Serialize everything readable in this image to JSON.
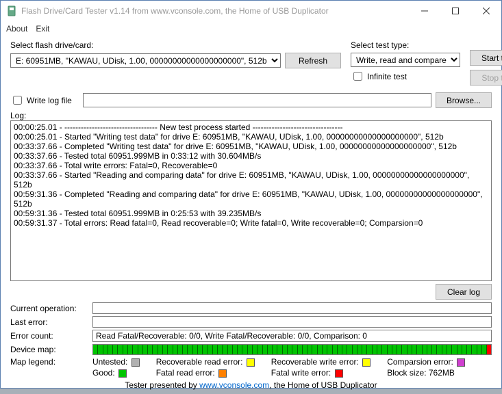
{
  "window": {
    "title": "Flash Drive/Card Tester v1.14 from www.vconsole.com, the Home of USB Duplicator"
  },
  "menu": {
    "about": "About",
    "exit": "Exit"
  },
  "labels": {
    "select_drive": "Select flash drive/card:",
    "select_test": "Select test type:",
    "infinite": "Infinite test",
    "write_log": "Write log file",
    "log": "Log:",
    "current_op": "Current operation:",
    "last_error": "Last error:",
    "error_count": "Error count:",
    "device_map": "Device map:",
    "map_legend": "Map legend:"
  },
  "buttons": {
    "refresh": "Refresh",
    "start": "Start test",
    "stop": "Stop test",
    "browse": "Browse...",
    "clear": "Clear log"
  },
  "drive_selected": "E: 60951MB, \"KAWAU, UDisk, 1.00, 00000000000000000000\", 512b",
  "test_selected": "Write, read and compare",
  "log_text": "00:00:25.01 - ---------------------------------- New test process started ---------------------------------\n00:00:25.01 - Started \"Writing test data\" for drive E: 60951MB, \"KAWAU, UDisk, 1.00, 00000000000000000000\", 512b\n00:33:37.66 - Completed \"Writing test data\" for drive E: 60951MB, \"KAWAU, UDisk, 1.00, 00000000000000000000\", 512b\n00:33:37.66 - Tested total 60951.999MB in 0:33:12 with 30.604MB/s\n00:33:37.66 - Total write errors: Fatal=0, Recoverable=0\n00:33:37.66 - Started \"Reading and comparing data\" for drive E: 60951MB, \"KAWAU, UDisk, 1.00, 00000000000000000000\", 512b\n00:59:31.36 - Completed \"Reading and comparing data\" for drive E: 60951MB, \"KAWAU, UDisk, 1.00, 00000000000000000000\", 512b\n00:59:31.36 - Tested total 60951.999MB in 0:25:53 with 39.235MB/s\n00:59:31.37 - Total errors: Read fatal=0, Read recoverable=0; Write fatal=0, Write recoverable=0; Comparsion=0",
  "error_count_text": "Read Fatal/Recoverable: 0/0, Write Fatal/Recoverable: 0/0, Comparison: 0",
  "legend": {
    "untested": "Untested:",
    "recov_read": "Recoverable read error:",
    "recov_write": "Recoverable write error:",
    "compar": "Comparsion error:",
    "good": "Good:",
    "fatal_read": "Fatal read error:",
    "fatal_write": "Fatal write error:",
    "block": "Block size: 762MB"
  },
  "footer": {
    "text": "Tester presented by ",
    "link": "www.vconsole.com",
    "tail": ", the Home of USB Duplicator"
  },
  "colors": {
    "untested": "#b0b0b0",
    "good": "#00c400",
    "recov_read": "#ffff00",
    "fatal_read": "#ff8000",
    "recov_write": "#ffff00",
    "fatal_write": "#ff0000",
    "compar": "#d040d0"
  }
}
